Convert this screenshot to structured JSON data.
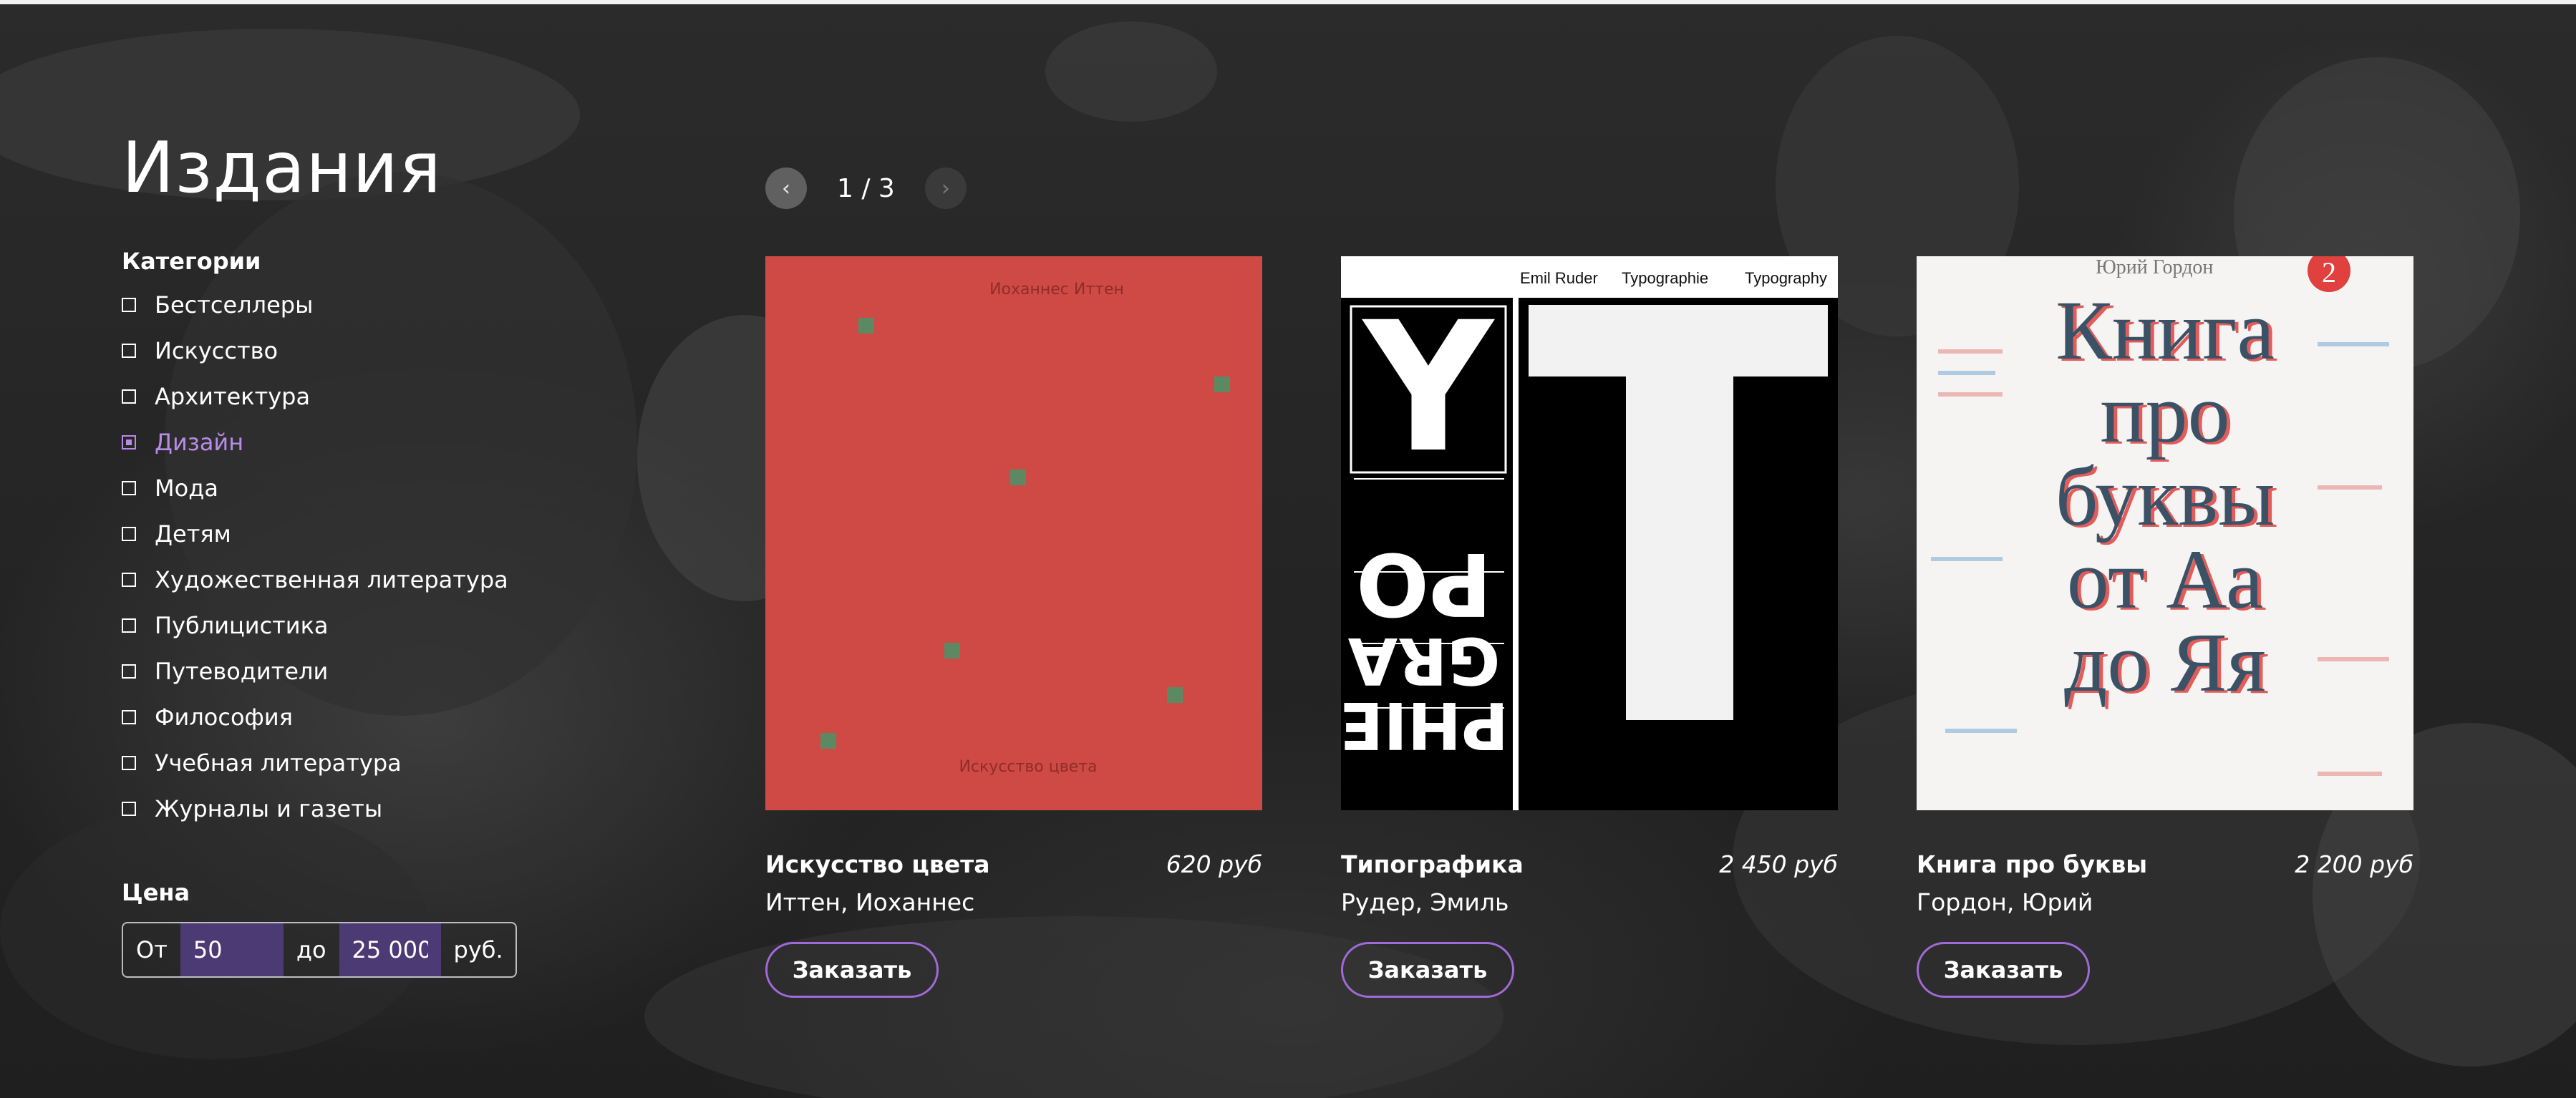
{
  "page_title": "Издания",
  "filters": {
    "categories_heading": "Категории",
    "categories": [
      {
        "label": "Бестселлеры",
        "selected": false
      },
      {
        "label": "Искусство",
        "selected": false
      },
      {
        "label": "Архитектура",
        "selected": false
      },
      {
        "label": "Дизайн",
        "selected": true
      },
      {
        "label": "Мода",
        "selected": false
      },
      {
        "label": "Детям",
        "selected": false
      },
      {
        "label": "Художественная литература",
        "selected": false
      },
      {
        "label": "Публицистика",
        "selected": false
      },
      {
        "label": "Путеводители",
        "selected": false
      },
      {
        "label": "Философия",
        "selected": false
      },
      {
        "label": "Учебная литература",
        "selected": false
      },
      {
        "label": "Журналы и газеты",
        "selected": false
      }
    ],
    "price_heading": "Цена",
    "price": {
      "from_label": "От",
      "from_value": "50",
      "to_label": "до",
      "to_value": "25 000",
      "currency_label": "руб."
    }
  },
  "pager": {
    "count_text": "1 / 3",
    "prev_icon": "chevron-left-icon",
    "next_icon": "chevron-right-icon"
  },
  "books": [
    {
      "title": "Искусство цвета",
      "author": "Иттен, Иоханнес",
      "price": "620 руб",
      "order_label": "Заказать",
      "cover": {
        "author_text": "Иоханнес Иттен",
        "title_text": "Искусство цвета",
        "background": "#cf4a44"
      }
    },
    {
      "title": "Типографика",
      "author": "Рудер, Эмиль",
      "price": "2 450 руб",
      "order_label": "Заказать",
      "cover": {
        "header_author": "Emil Ruder",
        "header_word1": "Typographie",
        "header_word2": "Typography"
      }
    },
    {
      "title": "Книга про буквы",
      "author": "Гордон, Юрий",
      "price": "2 200 руб",
      "order_label": "Заказать",
      "cover": {
        "author_text": "Юрий Гордон",
        "badge_text": "2",
        "title_line1": "Книга",
        "title_line2": "про",
        "title_line3": "буквы",
        "title_line4": "от Аа",
        "title_line5": "до Яя"
      }
    }
  ],
  "colors": {
    "accent": "#a06ad8",
    "active_category": "#b98be8",
    "price_input_bg": "#4c3a75"
  }
}
